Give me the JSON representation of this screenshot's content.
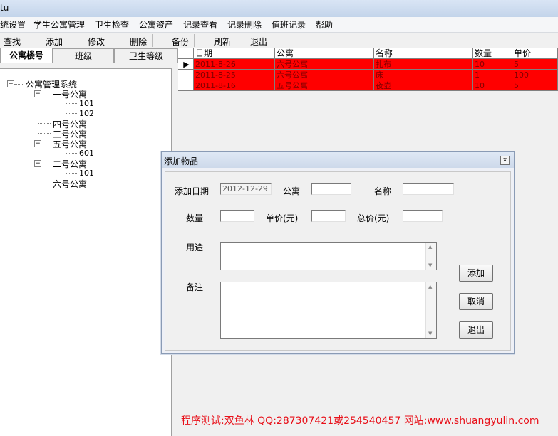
{
  "window": {
    "title": "tu"
  },
  "menu": [
    "统设置",
    "学生公寓管理",
    "卫生检查",
    "公寓资产",
    "记录查看",
    "记录删除",
    "值班记录",
    "帮助"
  ],
  "toolbar": {
    "find": "查找",
    "add": "添加",
    "edit": "修改",
    "delete": "删除",
    "backup": "备份",
    "refresh": "刷新",
    "exit": "退出"
  },
  "tabs": [
    "公寓楼号",
    "班级",
    "卫生等级"
  ],
  "tree": {
    "root": "公寓管理系统",
    "b1": "一号公寓",
    "r101": "101",
    "r102": "102",
    "b4": "四号公寓",
    "b3": "三号公寓",
    "b5": "五号公寓",
    "r601": "601",
    "b2": "二号公寓",
    "r101b": "101",
    "b6": "六号公寓",
    "expand": "−"
  },
  "grid": {
    "headers": [
      "日期",
      "公寓",
      "名称",
      "数量",
      "单价"
    ],
    "rows": [
      [
        "2011-8-26",
        "六号公寓",
        "扎布",
        "10",
        "5"
      ],
      [
        "2011-8-25",
        "六号公寓",
        "床",
        "1",
        "100"
      ],
      [
        "2011-8-16",
        "五号公寓",
        "夜壶",
        "10",
        "5"
      ]
    ],
    "row_indicator": "▶"
  },
  "dialog": {
    "title": "添加物品",
    "close": "x",
    "date_label": "添加日期",
    "date_value": "2012-12-29",
    "apartment_label": "公寓",
    "name_label": "名称",
    "qty_label": "数量",
    "unit_price_label": "单价(元)",
    "total_price_label": "总价(元)",
    "usage_label": "用途",
    "remark_label": "备注",
    "add_button": "添加",
    "cancel_button": "取消",
    "exit_button": "退出"
  },
  "footer": "程序测试:双鱼林 QQ:287307421或254540457 网站:www.shuangyulin.com",
  "colors": {
    "row_highlight": "#ff0000",
    "footer_text": "#e8111a"
  }
}
